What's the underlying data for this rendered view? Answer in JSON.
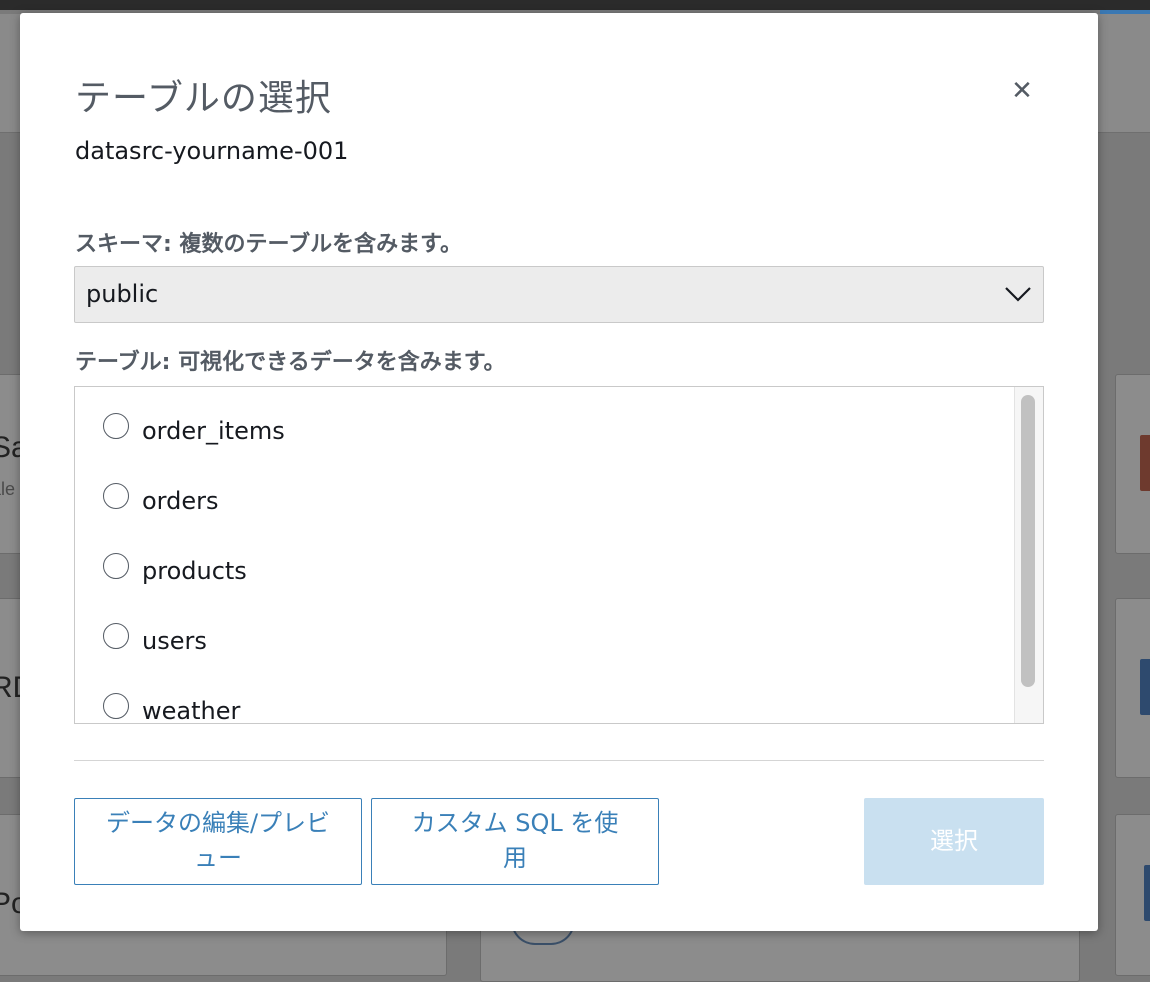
{
  "background": {
    "cards": [
      {
        "title": "Sa",
        "subtitle": "ale"
      },
      {
        "title": "RD",
        "subtitle": ""
      },
      {
        "title": "Po",
        "subtitle": ""
      }
    ]
  },
  "dialog": {
    "title": "テーブルの選択",
    "close_icon": "close-icon",
    "datasource_name": "datasrc-yourname-001",
    "schema_label": "スキーマ: 複数のテーブルを含みます。",
    "schema_selected": "public",
    "table_label": "テーブル: 可視化できるデータを含みます。",
    "tables": [
      {
        "name": "order_items",
        "selected": false
      },
      {
        "name": "orders",
        "selected": false
      },
      {
        "name": "products",
        "selected": false
      },
      {
        "name": "users",
        "selected": false
      },
      {
        "name": "weather",
        "selected": false
      }
    ],
    "buttons": {
      "edit_preview": "データの編集/プレビュー",
      "custom_sql": "カスタム SQL を使用",
      "select": "選択"
    },
    "colors": {
      "accent": "#3a80b8",
      "select_disabled_bg": "#c9e0f0",
      "heading": "#545b64"
    }
  }
}
